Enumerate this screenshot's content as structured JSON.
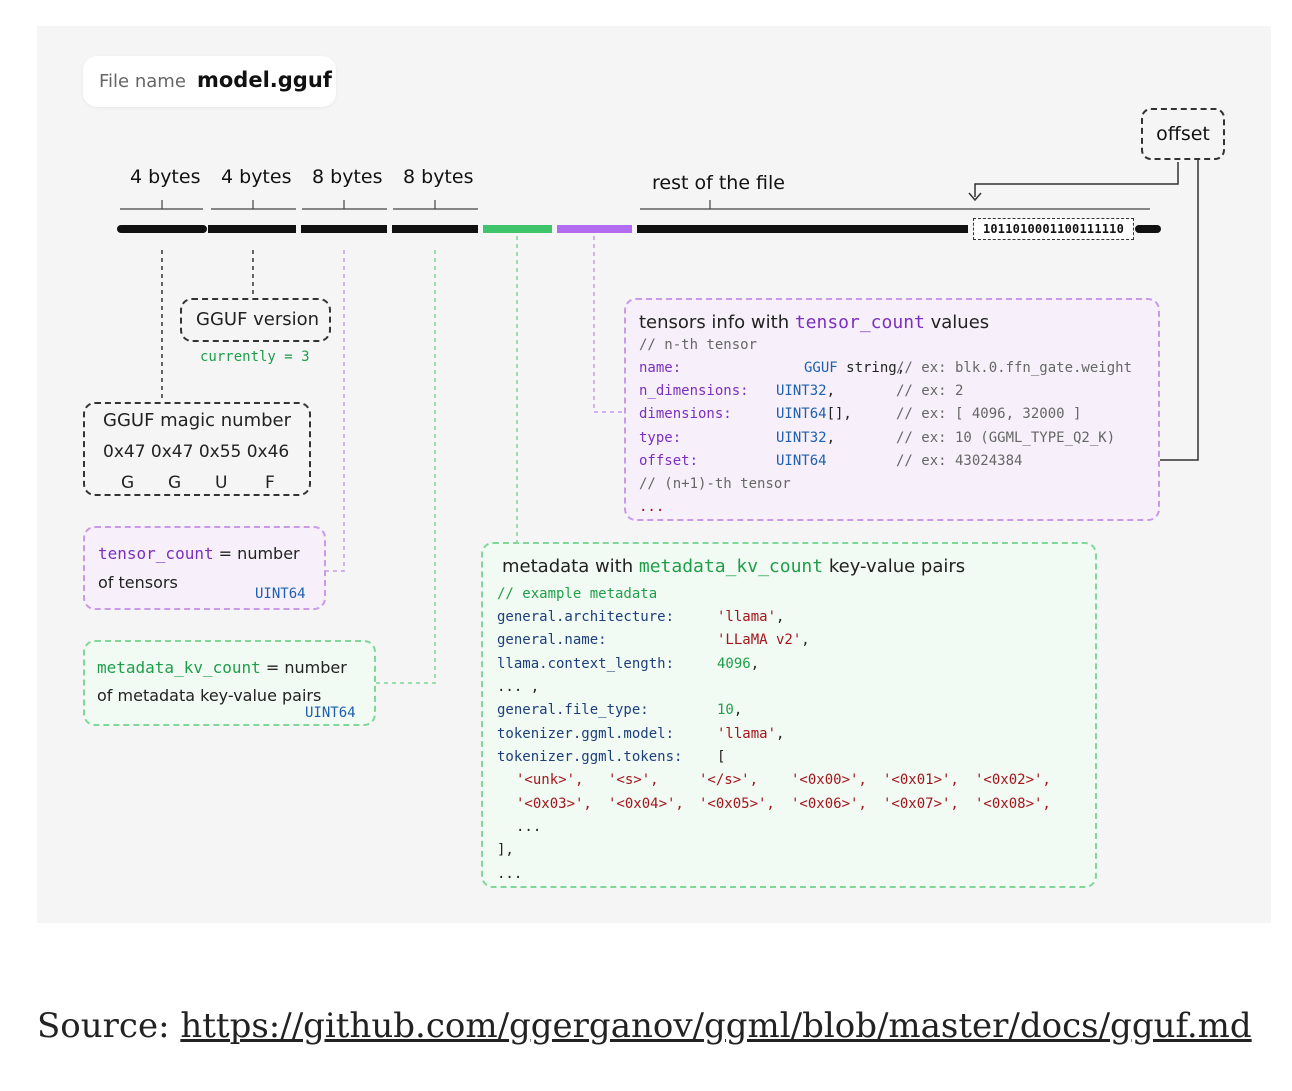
{
  "file_name": {
    "label": "File name",
    "value": "model.gguf"
  },
  "byte_labels": [
    "4 bytes",
    "4 bytes",
    "8 bytes",
    "8 bytes"
  ],
  "rest_label": "rest of the file",
  "offset_label": "offset",
  "offset_bits": "1011010001100111110",
  "colors": {
    "black": "#111111",
    "green": "#3fc46b",
    "purple": "#b16cf0",
    "panel": "#f5f5f6"
  },
  "version_box": {
    "title": "GGUF version",
    "note": "currently = 3"
  },
  "magic_box": {
    "title": "GGUF magic number",
    "hex": "0x47 0x47 0x55 0x46",
    "letters": [
      "G",
      "G",
      "U",
      "F"
    ]
  },
  "tensor_count_box": {
    "key": "tensor_count",
    "eq": " = number",
    "line2": "of tensors",
    "type": "UINT64"
  },
  "kv_count_box": {
    "key": "metadata_kv_count",
    "eq": " = number",
    "line2": "of metadata key-value pairs",
    "type": "UINT64"
  },
  "tensors_info": {
    "title_pre": "tensors info with ",
    "title_key": "tensor_count",
    "title_post": " values",
    "comment1": "// n-th tensor",
    "rows": [
      {
        "field": "name:",
        "type": "GGUF",
        "type_rest": " string,",
        "comment": "// ex: blk.0.ffn_gate.weight"
      },
      {
        "field": "n_dimensions:",
        "type": "UINT32",
        "type_rest": ",",
        "comment": "// ex: 2"
      },
      {
        "field": "dimensions:",
        "type": "UINT64",
        "type_rest": "[],",
        "comment": "// ex: [ 4096, 32000 ]"
      },
      {
        "field": "type:",
        "type": "UINT32",
        "type_rest": ",",
        "comment": "// ex: 10 (GGML_TYPE_Q2_K)"
      },
      {
        "field": "offset:",
        "type": "UINT64",
        "type_rest": "",
        "comment": "// ex: 43024384"
      }
    ],
    "comment2": "// (n+1)-th tensor",
    "ellipsis": "..."
  },
  "metadata": {
    "title_pre": "metadata with ",
    "title_key": "metadata_kv_count",
    "title_post": " key-value pairs",
    "comment": "// example metadata",
    "rows": [
      {
        "key": "general.architecture:",
        "value": "'llama'",
        "trail": ","
      },
      {
        "key": "general.name:",
        "value": "'LLaMA v2'",
        "trail": ","
      },
      {
        "key": "llama.context_length:",
        "value": "4096",
        "trail": ","
      },
      {
        "key": "... ,",
        "value": "",
        "trail": ""
      },
      {
        "key": "general.file_type:",
        "value": "10",
        "trail": ","
      },
      {
        "key": "tokenizer.ggml.model:",
        "value": "'llama'",
        "trail": ","
      },
      {
        "key": "tokenizer.ggml.tokens:",
        "value": "",
        "trail": "["
      }
    ],
    "tokens_row1": [
      "'<unk>',",
      "'<s>',",
      "'</s>',",
      "'<0x00>',",
      "'<0x01>',",
      "'<0x02>',"
    ],
    "tokens_row2": [
      "'<0x03>',",
      "'<0x04>',",
      "'<0x05>',",
      "'<0x06>',",
      "'<0x07>',",
      "'<0x08>',"
    ],
    "inner_ellipsis": "...",
    "close": "],",
    "end": "..."
  },
  "source": {
    "prefix": "Source: ",
    "url": "https://github.com/ggerganov/ggml/blob/master/docs/gguf.md"
  }
}
